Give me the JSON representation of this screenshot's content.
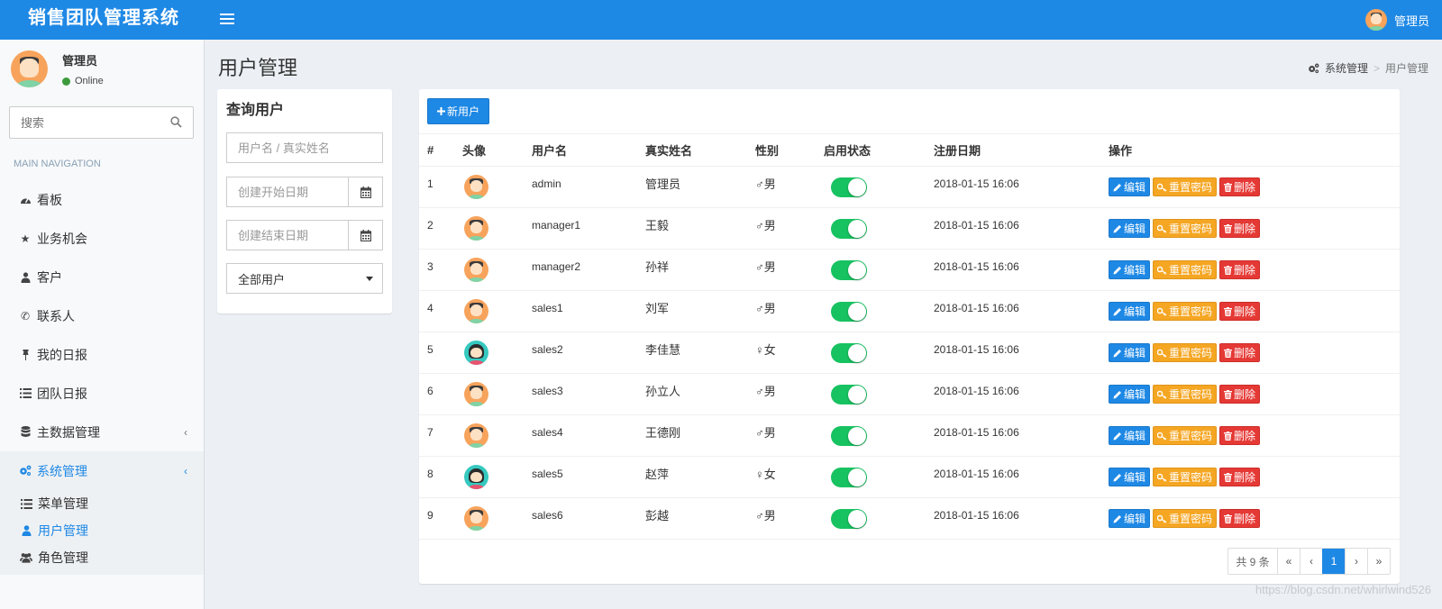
{
  "app": {
    "brand": "销售团队管理系统"
  },
  "header": {
    "user_name": "管理员"
  },
  "sidebar": {
    "user": {
      "name": "管理员",
      "status": "Online"
    },
    "search_placeholder": "搜索",
    "nav_header": "MAIN NAVIGATION",
    "items": [
      {
        "label": "看板",
        "icon": "dashboard-icon"
      },
      {
        "label": "业务机会",
        "icon": "star-icon"
      },
      {
        "label": "客户",
        "icon": "user-tie-icon"
      },
      {
        "label": "联系人",
        "icon": "phone-icon"
      },
      {
        "label": "我的日报",
        "icon": "pin-icon"
      },
      {
        "label": "团队日报",
        "icon": "list-icon"
      },
      {
        "label": "主数据管理",
        "icon": "database-icon"
      },
      {
        "label": "系统管理",
        "icon": "cogs-icon"
      }
    ],
    "sub_items": [
      {
        "label": "菜单管理",
        "icon": "list-icon"
      },
      {
        "label": "用户管理",
        "icon": "user-icon"
      },
      {
        "label": "角色管理",
        "icon": "users-icon"
      }
    ]
  },
  "page": {
    "title": "用户管理",
    "breadcrumb": [
      "系统管理",
      "用户管理"
    ]
  },
  "query": {
    "title": "查询用户",
    "name_placeholder": "用户名 / 真实姓名",
    "start_placeholder": "创建开始日期",
    "end_placeholder": "创建结束日期",
    "filter_selected": "全部用户"
  },
  "list": {
    "new_button": "新用户",
    "columns": [
      "#",
      "头像",
      "用户名",
      "真实姓名",
      "性别",
      "启用状态",
      "注册日期",
      "操作"
    ],
    "actions": {
      "edit": "编辑",
      "reset": "重置密码",
      "delete": "删除"
    },
    "rows": [
      {
        "no": "1",
        "avatar": "male",
        "username": "admin",
        "realname": "管理员",
        "gender": "♂男",
        "enabled": true,
        "date": "2018-01-15 16:06"
      },
      {
        "no": "2",
        "avatar": "male",
        "username": "manager1",
        "realname": "王毅",
        "gender": "♂男",
        "enabled": true,
        "date": "2018-01-15 16:06"
      },
      {
        "no": "3",
        "avatar": "male",
        "username": "manager2",
        "realname": "孙祥",
        "gender": "♂男",
        "enabled": true,
        "date": "2018-01-15 16:06"
      },
      {
        "no": "4",
        "avatar": "male",
        "username": "sales1",
        "realname": "刘军",
        "gender": "♂男",
        "enabled": true,
        "date": "2018-01-15 16:06"
      },
      {
        "no": "5",
        "avatar": "female",
        "username": "sales2",
        "realname": "李佳慧",
        "gender": "♀女",
        "enabled": true,
        "date": "2018-01-15 16:06"
      },
      {
        "no": "6",
        "avatar": "male",
        "username": "sales3",
        "realname": "孙立人",
        "gender": "♂男",
        "enabled": true,
        "date": "2018-01-15 16:06"
      },
      {
        "no": "7",
        "avatar": "male",
        "username": "sales4",
        "realname": "王德刚",
        "gender": "♂男",
        "enabled": true,
        "date": "2018-01-15 16:06"
      },
      {
        "no": "8",
        "avatar": "female",
        "username": "sales5",
        "realname": "赵萍",
        "gender": "♀女",
        "enabled": true,
        "date": "2018-01-15 16:06"
      },
      {
        "no": "9",
        "avatar": "male",
        "username": "sales6",
        "realname": "彭越",
        "gender": "♂男",
        "enabled": true,
        "date": "2018-01-15 16:06"
      }
    ],
    "pagination": {
      "total": "共 9 条",
      "first": "«",
      "prev": "‹",
      "current": "1",
      "next": "›",
      "last": "»"
    }
  },
  "watermark": "https://blog.csdn.net/whirlwind526",
  "colors": {
    "primary": "#1e88e5",
    "warning": "#f5a623",
    "danger": "#e53935",
    "toggle_on": "#17c260"
  }
}
